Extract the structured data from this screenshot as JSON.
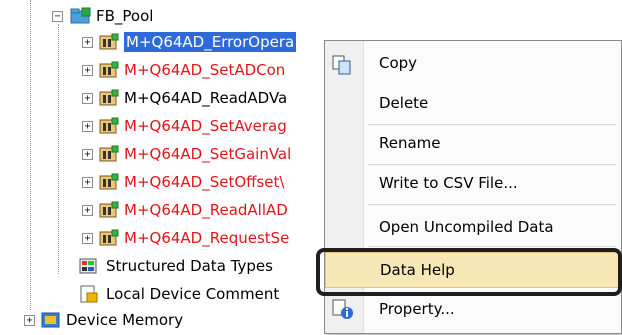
{
  "tree": {
    "root_label": "FB_Pool",
    "items": [
      {
        "label": "M+Q64AD_ErrorOpera",
        "state": "selected"
      },
      {
        "label": "M+Q64AD_SetADCon",
        "state": "red"
      },
      {
        "label": "M+Q64AD_ReadADVa",
        "state": "normal"
      },
      {
        "label": "M+Q64AD_SetAverag",
        "state": "red"
      },
      {
        "label": "M+Q64AD_SetGainVal",
        "state": "red"
      },
      {
        "label": "M+Q64AD_SetOffset\\",
        "state": "red"
      },
      {
        "label": "M+Q64AD_ReadAllAD",
        "state": "red"
      },
      {
        "label": "M+Q64AD_RequestSe",
        "state": "red"
      }
    ],
    "structured_data_types": "Structured Data Types",
    "local_device_comment": "Local Device Comment",
    "device_memory": "Device Memory"
  },
  "context_menu": {
    "items": [
      {
        "label": "Copy"
      },
      {
        "label": "Delete"
      },
      {
        "label": "Rename"
      },
      {
        "label": "Write to CSV File..."
      },
      {
        "label": "Open Uncompiled Data"
      },
      {
        "label": "Data Help"
      },
      {
        "label": "Property..."
      }
    ]
  },
  "colors": {
    "selection": "#2f6bd8",
    "error_text": "#e5141b",
    "menu_highlight": "#f8e7b7"
  }
}
